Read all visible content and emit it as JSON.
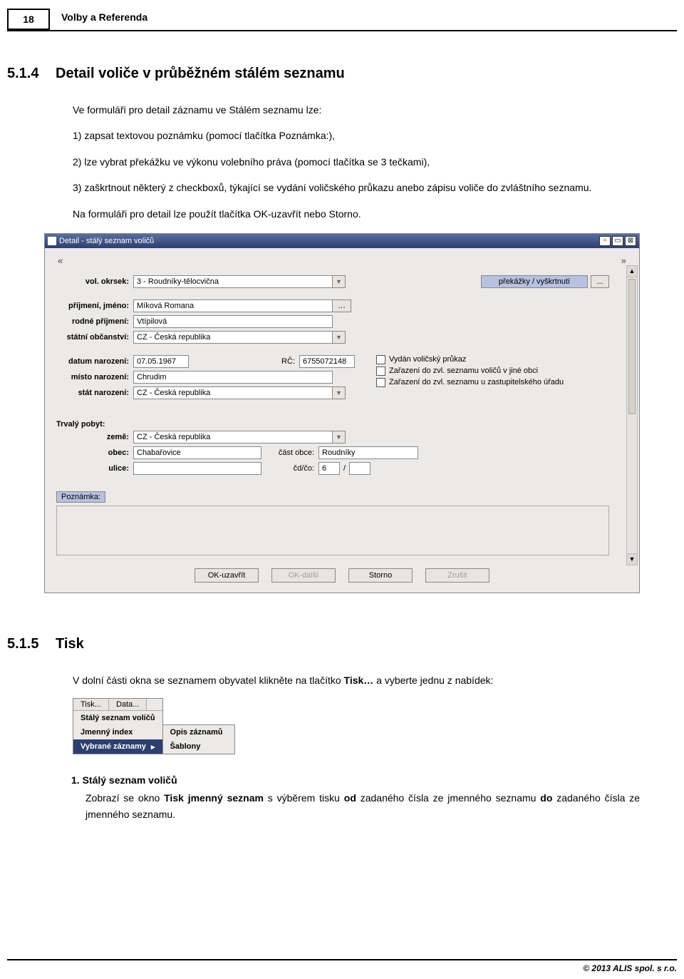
{
  "header": {
    "page_number": "18",
    "title": "Volby a Referenda"
  },
  "section514": {
    "num": "5.1.4",
    "title": "Detail voliče v průběžném stálém seznamu",
    "intro": "Ve formuláři pro detail záznamu ve Stálém seznamu lze:",
    "items": [
      "1) zapsat textovou poznámku (pomocí tlačítka Poznámka:),",
      "2) lze vybrat překážku ve výkonu volebního práva (pomocí tlačítka se 3 tečkami),",
      "3) zaškrtnout některý z checkboxů, týkající se vydání voličského průkazu anebo zápisu voliče do zvláštního seznamu."
    ],
    "outro": "Na formuláři pro detail lze použít tlačítka OK-uzavřít nebo Storno."
  },
  "appwindow": {
    "title": "Detail - stálý seznam voličů",
    "labels": {
      "vol_okrsek": "vol. okrsek:",
      "prijmeni_jmeno": "příjmení, jméno:",
      "rodne_prijmeni": "rodné příjmení:",
      "statni_obcanstvi": "státní občanství:",
      "datum_narozeni": "datum narození:",
      "rc": "RČ:",
      "misto_narozeni": "místo narození:",
      "stat_narozeni": "stát narození:",
      "trvaly_pobyt": "Trvalý pobyt:",
      "zeme": "země:",
      "obec": "obec:",
      "cast_obce": "část obce:",
      "ulice": "ulice:",
      "cd_co": "čd/čo:",
      "poznamka": "Poznámka:"
    },
    "values": {
      "vol_okrsek": "3 - Roudníky-tělocvična",
      "prijmeni_jmeno": "Míková Romana",
      "rodne_prijmeni": "Vtípilová",
      "statni_obcanstvi": "CZ - Česká republika",
      "datum_narozeni": "07.05.1967",
      "rc": "6755072148",
      "misto_narozeni": "Chrudim",
      "stat_narozeni": "CZ - Česká republika",
      "zeme": "CZ - Česká republika",
      "obec": "Chabařovice",
      "cast_obce": "Roudníky",
      "ulice": "",
      "cd": "6",
      "co": ""
    },
    "checkboxes": {
      "prukaz": "Vydán voličský průkaz",
      "zarazeni_obce": "Zařazení do zvl. seznamu voličů v jiné obci",
      "zarazeni_urad": "Zařazení do zvl. seznamu u zastupitelského úřadu"
    },
    "buttons": {
      "prekazky": "překážky / vyškrtnutí",
      "dots": "...",
      "ok_uzavrit": "OK-uzavřít",
      "ok_dalsi": "OK-další",
      "storno": "Storno",
      "zrusit": "Zrušit"
    }
  },
  "section515": {
    "num": "5.1.5",
    "title": "Tisk",
    "intro_pre": "V dolní části okna se seznamem obyvatel klikněte na tlačítko ",
    "intro_bold": "Tisk…",
    "intro_post": " a vyberte jednu z nabídek:",
    "menu": {
      "tab_tisk": "Tisk...",
      "tab_data": "Data...",
      "items": [
        "Stálý seznam voličů",
        "Jmenný index",
        "Vybrané záznamy"
      ],
      "sub_items": [
        "Opis záznamů",
        "Šablony"
      ]
    },
    "li1_head": "1. Stálý seznam voličů",
    "li1_body_pre": "Zobrazí se okno ",
    "li1_body_b1": "Tisk jmenný seznam",
    "li1_body_mid1": " s výběrem tisku ",
    "li1_body_b2": "od",
    "li1_body_mid2": " zadaného čísla ze jmenného seznamu ",
    "li1_body_b3": "do",
    "li1_body_post": " zadaného čísla ze jmenného seznamu."
  },
  "footer": {
    "copyright": "© 2013 ALIS spol. s r.o."
  }
}
